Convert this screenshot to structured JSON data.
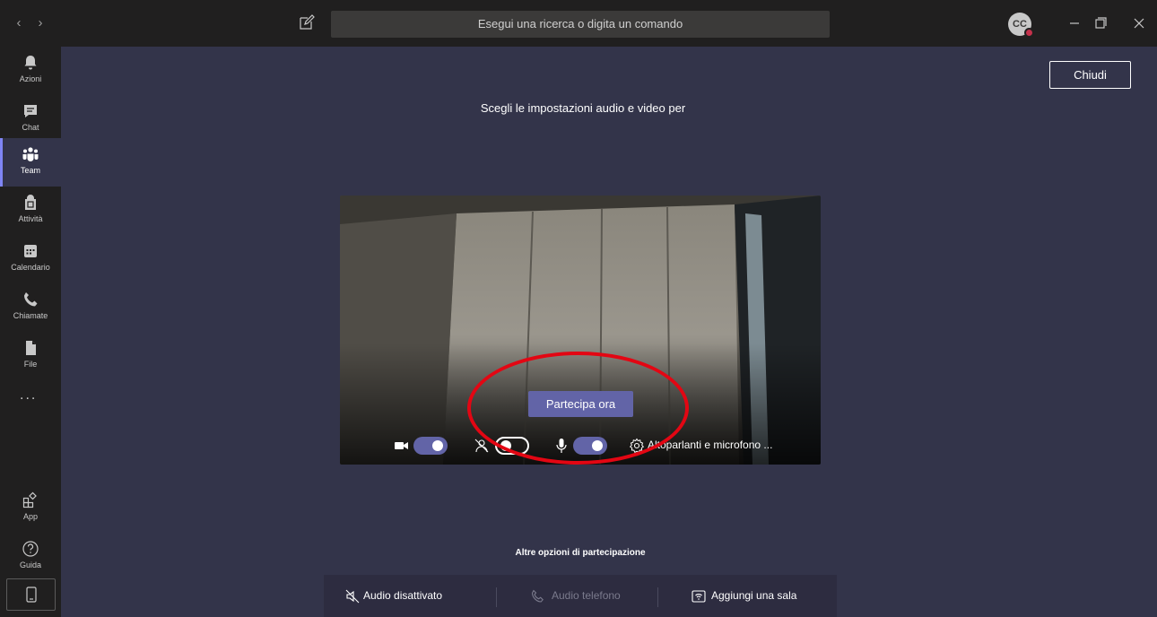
{
  "topbar": {
    "search_placeholder": "Esegui una ricerca o digita un comando",
    "avatar_initials": "CC",
    "status_color": "#c4314b"
  },
  "rail": {
    "items": [
      {
        "label": "Azioni",
        "icon": "bell-icon"
      },
      {
        "label": "Chat",
        "icon": "chat-icon"
      },
      {
        "label": "Team",
        "icon": "teams-icon",
        "active": true
      },
      {
        "label": "Attività",
        "icon": "assignments-icon"
      },
      {
        "label": "Calendario",
        "icon": "calendar-icon"
      },
      {
        "label": "Chiamate",
        "icon": "phone-icon"
      },
      {
        "label": "File",
        "icon": "file-icon"
      }
    ],
    "more": "...",
    "bottom": [
      {
        "label": "App",
        "icon": "apps-icon"
      },
      {
        "label": "Guida",
        "icon": "help-icon"
      }
    ]
  },
  "main": {
    "close_label": "Chiudi",
    "heading": "Scegli le impostazioni audio e video per",
    "join_label": "Partecipa ora",
    "speaker_label": "Altoparlanti e microfono ...",
    "camera_on": true,
    "blur_on": false,
    "mic_on": true,
    "other_options_title": "Altre opzioni di partecipazione",
    "options": [
      {
        "label": "Audio disattivato",
        "enabled": true
      },
      {
        "label": "Audio telefono",
        "enabled": false
      },
      {
        "label": "Aggiungi una sala",
        "enabled": true
      }
    ]
  },
  "colors": {
    "accent": "#6264a7",
    "annotation": "#e30613",
    "background": "#33344a"
  }
}
